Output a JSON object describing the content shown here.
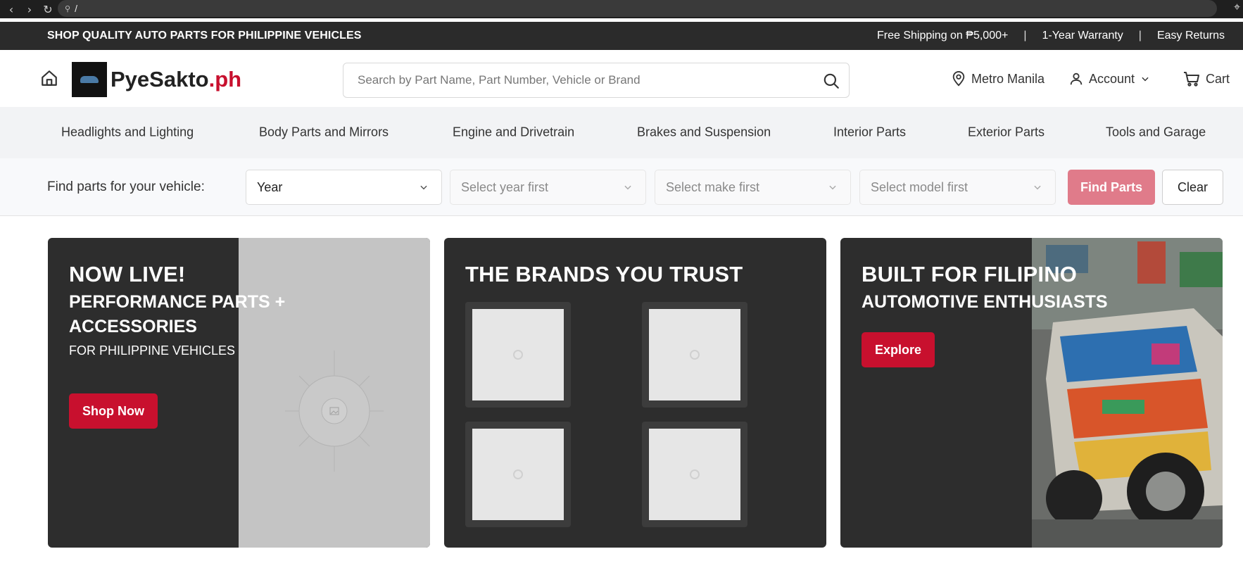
{
  "browser": {
    "url": "/"
  },
  "topbar": {
    "announcement": "SHOP QUALITY AUTO PARTS FOR PHILIPPINE VEHICLES",
    "perks": [
      "Free Shipping on ₱5,000+",
      "1-Year Warranty",
      "Easy Returns"
    ],
    "separator": "|"
  },
  "header": {
    "logo_main": "PyeSakto",
    "logo_suffix": ".ph",
    "search_placeholder": "Search by Part Name, Part Number, Vehicle or Brand",
    "location": "Metro Manila",
    "account": "Account",
    "cart": "Cart"
  },
  "categories": [
    "Headlights and Lighting",
    "Body Parts and Mirrors",
    "Engine and Drivetrain",
    "Brakes and Suspension",
    "Interior Parts",
    "Exterior Parts",
    "Tools and Garage"
  ],
  "finder": {
    "label": "Find parts for your vehicle:",
    "year": "Year",
    "make": "Select year first",
    "model": "Select make first",
    "submodel": "Select model first",
    "find_button": "Find Parts",
    "clear_button": "Clear"
  },
  "promos": {
    "card1": {
      "title": "NOW LIVE!",
      "subtitle": "PERFORMANCE PARTS + ACCESSORIES",
      "note": "FOR PHILIPPINE VEHICLES",
      "cta": "Shop Now"
    },
    "card2": {
      "title": "THE BRANDS YOU TRUST"
    },
    "card3": {
      "title": "BUILT FOR FILIPINO",
      "subtitle": "AUTOMOTIVE ENTHUSIASTS",
      "cta": "Explore"
    }
  },
  "colors": {
    "brand_red": "#c8102e",
    "dark": "#2b2b2b",
    "find_button_disabled": "#e07b8a"
  }
}
